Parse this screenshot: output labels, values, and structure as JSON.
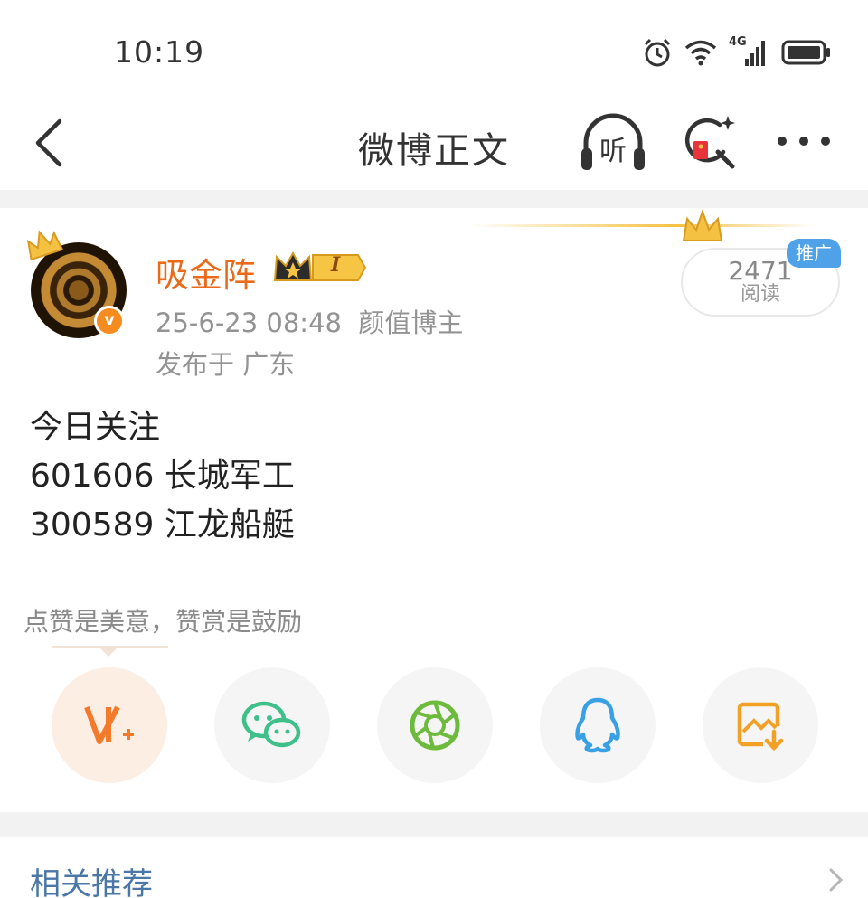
{
  "status_bar": {
    "time": "10:19",
    "network": "4G",
    "icons": [
      "alarm-icon",
      "wifi-icon",
      "signal-icon",
      "battery-icon"
    ]
  },
  "nav": {
    "title": "微博正文",
    "listen_label": "听",
    "icons": [
      "back-icon",
      "listen-icon",
      "search-redpacket-icon",
      "more-icon"
    ]
  },
  "post": {
    "username": "吸金阵",
    "level_badge": "I",
    "meta": "25-6-23 08:48  颜值博主",
    "location": "发布于 广东",
    "read_count": "2471",
    "read_label": "阅读",
    "promo_tag": "推广",
    "content_lines": [
      "今日关注",
      "601606 长城军工",
      "300589 江龙船艇"
    ],
    "reward_text": "点赞是美意，赞赏是鼓励"
  },
  "share": {
    "buttons": [
      {
        "name": "vip-reward",
        "icon": "vip-plus-icon",
        "color": "#f37a2b"
      },
      {
        "name": "wechat",
        "icon": "wechat-icon",
        "color": "#3fbf8a"
      },
      {
        "name": "moments",
        "icon": "camera-shutter-icon",
        "color": "#6dbb3c"
      },
      {
        "name": "qq",
        "icon": "qq-penguin-icon",
        "color": "#3aa0e6"
      },
      {
        "name": "save-image",
        "icon": "save-image-icon",
        "color": "#f2a126"
      }
    ]
  },
  "related": {
    "title": "相关推荐"
  },
  "colors": {
    "accent": "#eb6a1a",
    "link": "#4a76a8",
    "muted": "#939393",
    "promo": "#4fa2e8"
  }
}
